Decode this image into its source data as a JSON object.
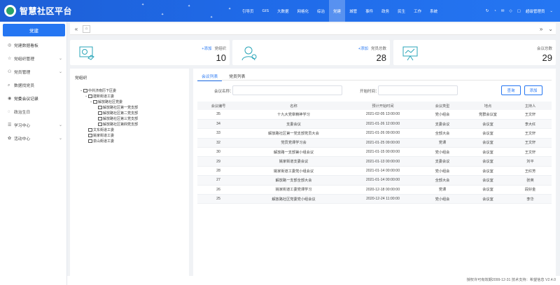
{
  "app": {
    "title": "智慧社区平台"
  },
  "nav": {
    "items": [
      "引导页",
      "GIS",
      "大数据",
      "网格化",
      "综治",
      "党建",
      "城管",
      "事件",
      "政务",
      "民生",
      "工作",
      "系统"
    ],
    "active_index": 5,
    "user": "超级管理员"
  },
  "sidebar": {
    "header": "党建",
    "items": [
      {
        "label": "党建数据看板",
        "icon": "dashboard-icon",
        "arrow": ""
      },
      {
        "label": "党组织管理",
        "icon": "star-icon",
        "arrow": "⌄"
      },
      {
        "label": "党员管理",
        "icon": "user-icon",
        "arrow": "⌄"
      },
      {
        "label": "数据找党员",
        "icon": "search-icon",
        "arrow": ""
      },
      {
        "label": "党委会议记录",
        "icon": "record-icon",
        "arrow": ""
      },
      {
        "label": "政治生日",
        "icon": "birthday-icon",
        "arrow": ""
      },
      {
        "label": "学习中心",
        "icon": "study-icon",
        "arrow": "⌄"
      },
      {
        "label": "活动中心",
        "icon": "activity-icon",
        "arrow": "⌄"
      }
    ],
    "active_index": 4
  },
  "stats": {
    "org": {
      "add": "+添加",
      "label": "党组织",
      "value": "10"
    },
    "member": {
      "add": "+添加",
      "label": "党员总数",
      "value": "28"
    },
    "meeting": {
      "label": "会议总数",
      "value": "29"
    }
  },
  "org_panel": {
    "title": "党组织",
    "tree": [
      {
        "label": "中共济南历下区委",
        "level": 0,
        "chev": "⌄"
      },
      {
        "label": "建新街道工委",
        "level": 1,
        "chev": "⌄"
      },
      {
        "label": "解放路社区党委",
        "level": 2,
        "chev": "⌄"
      },
      {
        "label": "解放路社区第一党支部",
        "level": 3,
        "chev": ""
      },
      {
        "label": "解放路社区第二党支部",
        "level": 3,
        "chev": ""
      },
      {
        "label": "解放路社区第三党支部",
        "level": 3,
        "chev": ""
      },
      {
        "label": "解放路社区第四党支部",
        "level": 3,
        "chev": ""
      },
      {
        "label": "文东街道工委",
        "level": 1,
        "chev": ""
      },
      {
        "label": "姚家街道工委",
        "level": 1,
        "chev": ""
      },
      {
        "label": "泉山街道工委",
        "level": 1,
        "chev": ""
      }
    ]
  },
  "main": {
    "tabs": [
      "会议列表",
      "党员列表"
    ],
    "active_tab": 0,
    "search": {
      "name_label": "会议名称：",
      "name_placeholder": "",
      "time_label": "开始时间：",
      "time_placeholder": "",
      "query": "查询",
      "reset": "添加"
    },
    "columns": [
      "会议编号",
      "名称",
      "预计开始时间",
      "会议类型",
      "地点",
      "主持人"
    ],
    "rows": [
      [
        "35",
        "十九大党章精神学习",
        "2021-02-05 13:00:00",
        "党小组会",
        "党群会议室",
        "王文轩"
      ],
      [
        "34",
        "支委会议",
        "2021-01-26 12:00:00",
        "支委会议",
        "会议室",
        "李大红"
      ],
      [
        "33",
        "解放路社区第一党支部党员大会",
        "2021-01-26 09:00:00",
        "全部大会",
        "会议室",
        "王文轩"
      ],
      [
        "32",
        "党员党课学习会",
        "2021-01-25 09:00:00",
        "党课",
        "会议室",
        "王文轩"
      ],
      [
        "30",
        "解放路一支部第小组会议",
        "2021-01-15 00:00:00",
        "党小组会",
        "会议室",
        "王文轩"
      ],
      [
        "29",
        "姚家街道支委会议",
        "2021-01-13 00:00:00",
        "支委会议",
        "会议室",
        "刘平"
      ],
      [
        "28",
        "姚家街道工委党小组会议",
        "2021-01-14 00:00:00",
        "党小组会",
        "会议室",
        "王红芳"
      ],
      [
        "27",
        "解放路一支部全部大会",
        "2021-01-14 00:00:00",
        "全部大会",
        "会议室",
        "张英"
      ],
      [
        "26",
        "姚家街道工委党课学习",
        "2020-12-18 00:00:00",
        "党课",
        "会议室",
        "段好金"
      ],
      [
        "25",
        "解放路社区党委党小组会议",
        "2020-12-24 11:00:00",
        "党小组会",
        "会议室",
        "李华"
      ]
    ]
  },
  "footer": {
    "text": "授权许可有效期2099-12-31   技术支持：希望信息   V2.4.0"
  }
}
